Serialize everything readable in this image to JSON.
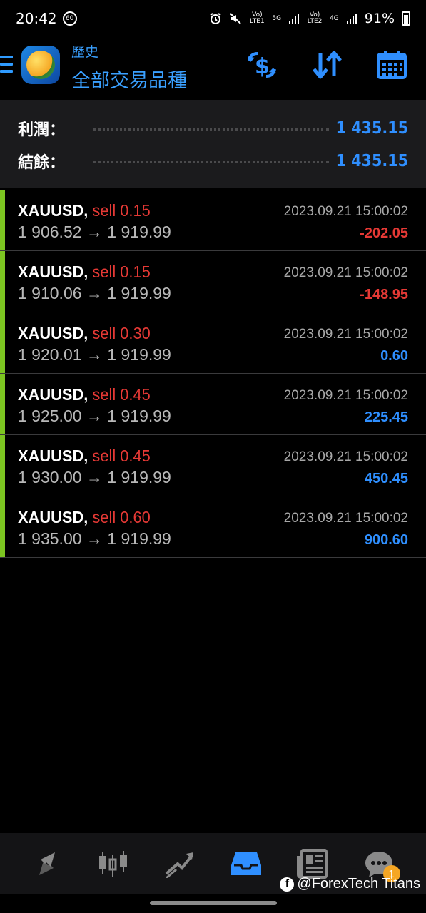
{
  "status": {
    "time": "20:42",
    "badge": "60",
    "net1_top": "Vo) LTE1",
    "net_5g": "5G",
    "net2_top": "Vo) LTE2",
    "net_4g": "4G",
    "battery": "91%"
  },
  "header": {
    "subtitle": "歷史",
    "title": "全部交易品種"
  },
  "summary": {
    "profit_label": "利潤：",
    "profit_value": "1 435.15",
    "balance_label": "結餘：",
    "balance_value": "1 435.15"
  },
  "trades": [
    {
      "symbol": "XAUUSD,",
      "type": "sell 0.15",
      "prices": "1 906.52 → 1 919.99",
      "time": "2023.09.21 15:00:02",
      "profit": "-202.05"
    },
    {
      "symbol": "XAUUSD,",
      "type": "sell 0.15",
      "prices": "1 910.06 → 1 919.99",
      "time": "2023.09.21 15:00:02",
      "profit": "-148.95"
    },
    {
      "symbol": "XAUUSD,",
      "type": "sell 0.30",
      "prices": "1 920.01 → 1 919.99",
      "time": "2023.09.21 15:00:02",
      "profit": "0.60"
    },
    {
      "symbol": "XAUUSD,",
      "type": "sell 0.45",
      "prices": "1 925.00 → 1 919.99",
      "time": "2023.09.21 15:00:02",
      "profit": "225.45"
    },
    {
      "symbol": "XAUUSD,",
      "type": "sell 0.45",
      "prices": "1 930.00 → 1 919.99",
      "time": "2023.09.21 15:00:02",
      "profit": "450.45"
    },
    {
      "symbol": "XAUUSD,",
      "type": "sell 0.60",
      "prices": "1 935.00 → 1 919.99",
      "time": "2023.09.21 15:00:02",
      "profit": "900.60"
    }
  ],
  "nav": {
    "items": [
      "quotes-icon",
      "chart-icon",
      "trade-icon",
      "history-icon",
      "news-icon",
      "chat-icon"
    ],
    "active": "history-icon",
    "chat_badge": "1"
  },
  "watermark": "@ForexTech Titans",
  "colors": {
    "accent": "#2f8fff",
    "sell": "#e53935",
    "bar": "#7cc521"
  }
}
